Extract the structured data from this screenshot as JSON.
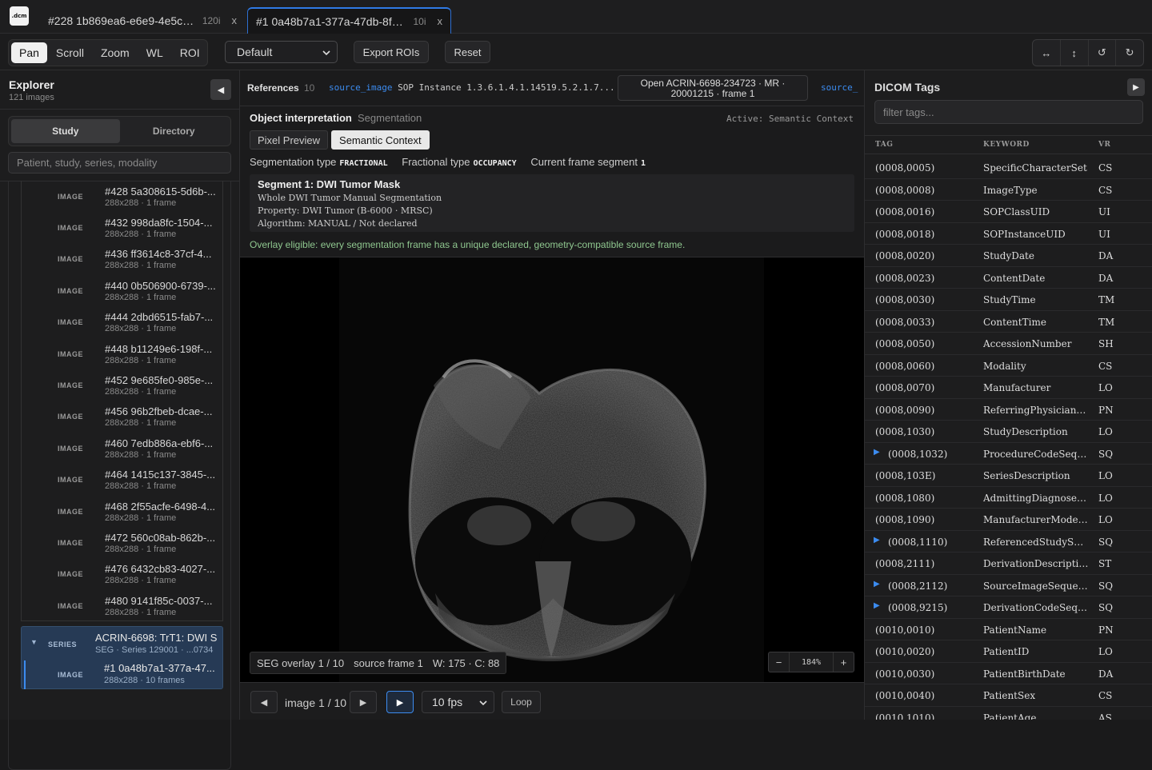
{
  "app": {
    "logo_text": ".dcm"
  },
  "tabs": [
    {
      "title": "#228 1b869ea6-e6e9-4e5c-b1...",
      "count": "120i",
      "close": "x"
    },
    {
      "title": "#1 0a48b7a1-377a-47db-8f17-...",
      "count": "10i",
      "close": "x"
    }
  ],
  "toolbar": {
    "modes": [
      "Pan",
      "Scroll",
      "Zoom",
      "WL",
      "ROI"
    ],
    "active_mode": "Pan",
    "preset": "Default",
    "export_label": "Export ROIs",
    "reset_label": "Reset",
    "transforms": [
      "↔",
      "↕",
      "↺",
      "↻"
    ]
  },
  "explorer": {
    "title": "Explorer",
    "subtitle": "121 images",
    "collapse": "◀",
    "views": [
      "Study",
      "Directory"
    ],
    "active_view": "Study",
    "search_placeholder": "Patient, study, series, modality",
    "images": [
      {
        "kind": "IMAGE",
        "name": "#428 5a308615-5d6b-...",
        "meta": "288x288 · 1 frame"
      },
      {
        "kind": "IMAGE",
        "name": "#432 998da8fc-1504-...",
        "meta": "288x288 · 1 frame"
      },
      {
        "kind": "IMAGE",
        "name": "#436 ff3614c8-37cf-4...",
        "meta": "288x288 · 1 frame"
      },
      {
        "kind": "IMAGE",
        "name": "#440 0b506900-6739-...",
        "meta": "288x288 · 1 frame"
      },
      {
        "kind": "IMAGE",
        "name": "#444 2dbd6515-fab7-...",
        "meta": "288x288 · 1 frame"
      },
      {
        "kind": "IMAGE",
        "name": "#448 b11249e6-198f-...",
        "meta": "288x288 · 1 frame"
      },
      {
        "kind": "IMAGE",
        "name": "#452 9e685fe0-985e-...",
        "meta": "288x288 · 1 frame"
      },
      {
        "kind": "IMAGE",
        "name": "#456 96b2fbeb-dcae-...",
        "meta": "288x288 · 1 frame"
      },
      {
        "kind": "IMAGE",
        "name": "#460 7edb886a-ebf6-...",
        "meta": "288x288 · 1 frame"
      },
      {
        "kind": "IMAGE",
        "name": "#464 1415c137-3845-...",
        "meta": "288x288 · 1 frame"
      },
      {
        "kind": "IMAGE",
        "name": "#468 2f55acfe-6498-4...",
        "meta": "288x288 · 1 frame"
      },
      {
        "kind": "IMAGE",
        "name": "#472 560c08ab-862b-...",
        "meta": "288x288 · 1 frame"
      },
      {
        "kind": "IMAGE",
        "name": "#476 6432cb83-4027-...",
        "meta": "288x288 · 1 frame"
      },
      {
        "kind": "IMAGE",
        "name": "#480 9141f85c-0037-...",
        "meta": "288x288 · 1 frame"
      }
    ],
    "series": {
      "caret": "▼",
      "kind": "SERIES",
      "name": "ACRIN-6698: TrT1: DWI S",
      "meta": "SEG · Series 129001 · ...0734",
      "image": {
        "kind": "IMAGE",
        "name": "#1 0a48b7a1-377a-47...",
        "meta": "288x288 · 10 frames"
      }
    }
  },
  "references": {
    "label": "References",
    "count": "10",
    "chip_key": "source_image",
    "chip_value": "SOP Instance 1.3.6.1.4.1.14519.5.2.1.7...",
    "open_label_line1": "Open ACRIN-6698-234723 · MR ·",
    "open_label_line2": "20001215 · frame 1",
    "chip2_key": "source_"
  },
  "interpretation": {
    "title": "Object interpretation",
    "kind": "Segmentation",
    "active": "Active: Semantic Context",
    "tabs": [
      "Pixel Preview",
      "Semantic Context"
    ],
    "active_tab": "Semantic Context",
    "seg_type_label": "Segmentation type",
    "seg_type": "FRACTIONAL",
    "frac_type_label": "Fractional type",
    "frac_type": "OCCUPANCY",
    "frame_seg_label": "Current frame segment",
    "frame_seg": "1",
    "segment_name": "Segment 1: DWI Tumor Mask",
    "segment_lines": [
      "Whole DWI Tumor Manual Segmentation",
      "Property: DWI Tumor (B-6000 · MRSC)",
      "Algorithm: MANUAL / Not declared"
    ],
    "eligible": "Overlay eligible: every segmentation frame has a unique declared, geometry-compatible source frame."
  },
  "viewer": {
    "overlay": "SEG overlay 1 / 10",
    "source_frame": "source frame 1",
    "wl": "W: 175 · C: 88",
    "zoom_minus": "−",
    "zoom": "184%",
    "zoom_plus": "+"
  },
  "playback": {
    "prev": "◀",
    "position": "image 1 / 10",
    "next": "▶",
    "play": "▶",
    "fps": "10 fps",
    "loop": "Loop"
  },
  "tags_panel": {
    "title": "DICOM Tags",
    "collapse": "▶",
    "filter_placeholder": "filter tags...",
    "columns": [
      "TAG",
      "KEYWORD",
      "VR"
    ],
    "rows": [
      {
        "tag": "(0008,0005)",
        "keyword": "SpecificCharacterSet",
        "vr": "CS",
        "seq": false
      },
      {
        "tag": "(0008,0008)",
        "keyword": "ImageType",
        "vr": "CS",
        "seq": false
      },
      {
        "tag": "(0008,0016)",
        "keyword": "SOPClassUID",
        "vr": "UI",
        "seq": false
      },
      {
        "tag": "(0008,0018)",
        "keyword": "SOPInstanceUID",
        "vr": "UI",
        "seq": false
      },
      {
        "tag": "(0008,0020)",
        "keyword": "StudyDate",
        "vr": "DA",
        "seq": false
      },
      {
        "tag": "(0008,0023)",
        "keyword": "ContentDate",
        "vr": "DA",
        "seq": false
      },
      {
        "tag": "(0008,0030)",
        "keyword": "StudyTime",
        "vr": "TM",
        "seq": false
      },
      {
        "tag": "(0008,0033)",
        "keyword": "ContentTime",
        "vr": "TM",
        "seq": false
      },
      {
        "tag": "(0008,0050)",
        "keyword": "AccessionNumber",
        "vr": "SH",
        "seq": false
      },
      {
        "tag": "(0008,0060)",
        "keyword": "Modality",
        "vr": "CS",
        "seq": false
      },
      {
        "tag": "(0008,0070)",
        "keyword": "Manufacturer",
        "vr": "LO",
        "seq": false
      },
      {
        "tag": "(0008,0090)",
        "keyword": "ReferringPhysicianName",
        "vr": "PN",
        "seq": false
      },
      {
        "tag": "(0008,1030)",
        "keyword": "StudyDescription",
        "vr": "LO",
        "seq": false
      },
      {
        "tag": "(0008,1032)",
        "keyword": "ProcedureCodeSequence",
        "vr": "SQ",
        "seq": true
      },
      {
        "tag": "(0008,103E)",
        "keyword": "SeriesDescription",
        "vr": "LO",
        "seq": false
      },
      {
        "tag": "(0008,1080)",
        "keyword": "AdmittingDiagnosesDescription",
        "vr": "LO",
        "seq": false
      },
      {
        "tag": "(0008,1090)",
        "keyword": "ManufacturerModelName",
        "vr": "LO",
        "seq": false
      },
      {
        "tag": "(0008,1110)",
        "keyword": "ReferencedStudySequence",
        "vr": "SQ",
        "seq": true
      },
      {
        "tag": "(0008,2111)",
        "keyword": "DerivationDescription",
        "vr": "ST",
        "seq": false
      },
      {
        "tag": "(0008,2112)",
        "keyword": "SourceImageSequence",
        "vr": "SQ",
        "seq": true
      },
      {
        "tag": "(0008,9215)",
        "keyword": "DerivationCodeSequence",
        "vr": "SQ",
        "seq": true
      },
      {
        "tag": "(0010,0010)",
        "keyword": "PatientName",
        "vr": "PN",
        "seq": false
      },
      {
        "tag": "(0010,0020)",
        "keyword": "PatientID",
        "vr": "LO",
        "seq": false
      },
      {
        "tag": "(0010,0030)",
        "keyword": "PatientBirthDate",
        "vr": "DA",
        "seq": false
      },
      {
        "tag": "(0010,0040)",
        "keyword": "PatientSex",
        "vr": "CS",
        "seq": false
      },
      {
        "tag": "(0010,1010)",
        "keyword": "PatientAge",
        "vr": "AS",
        "seq": false
      }
    ]
  }
}
